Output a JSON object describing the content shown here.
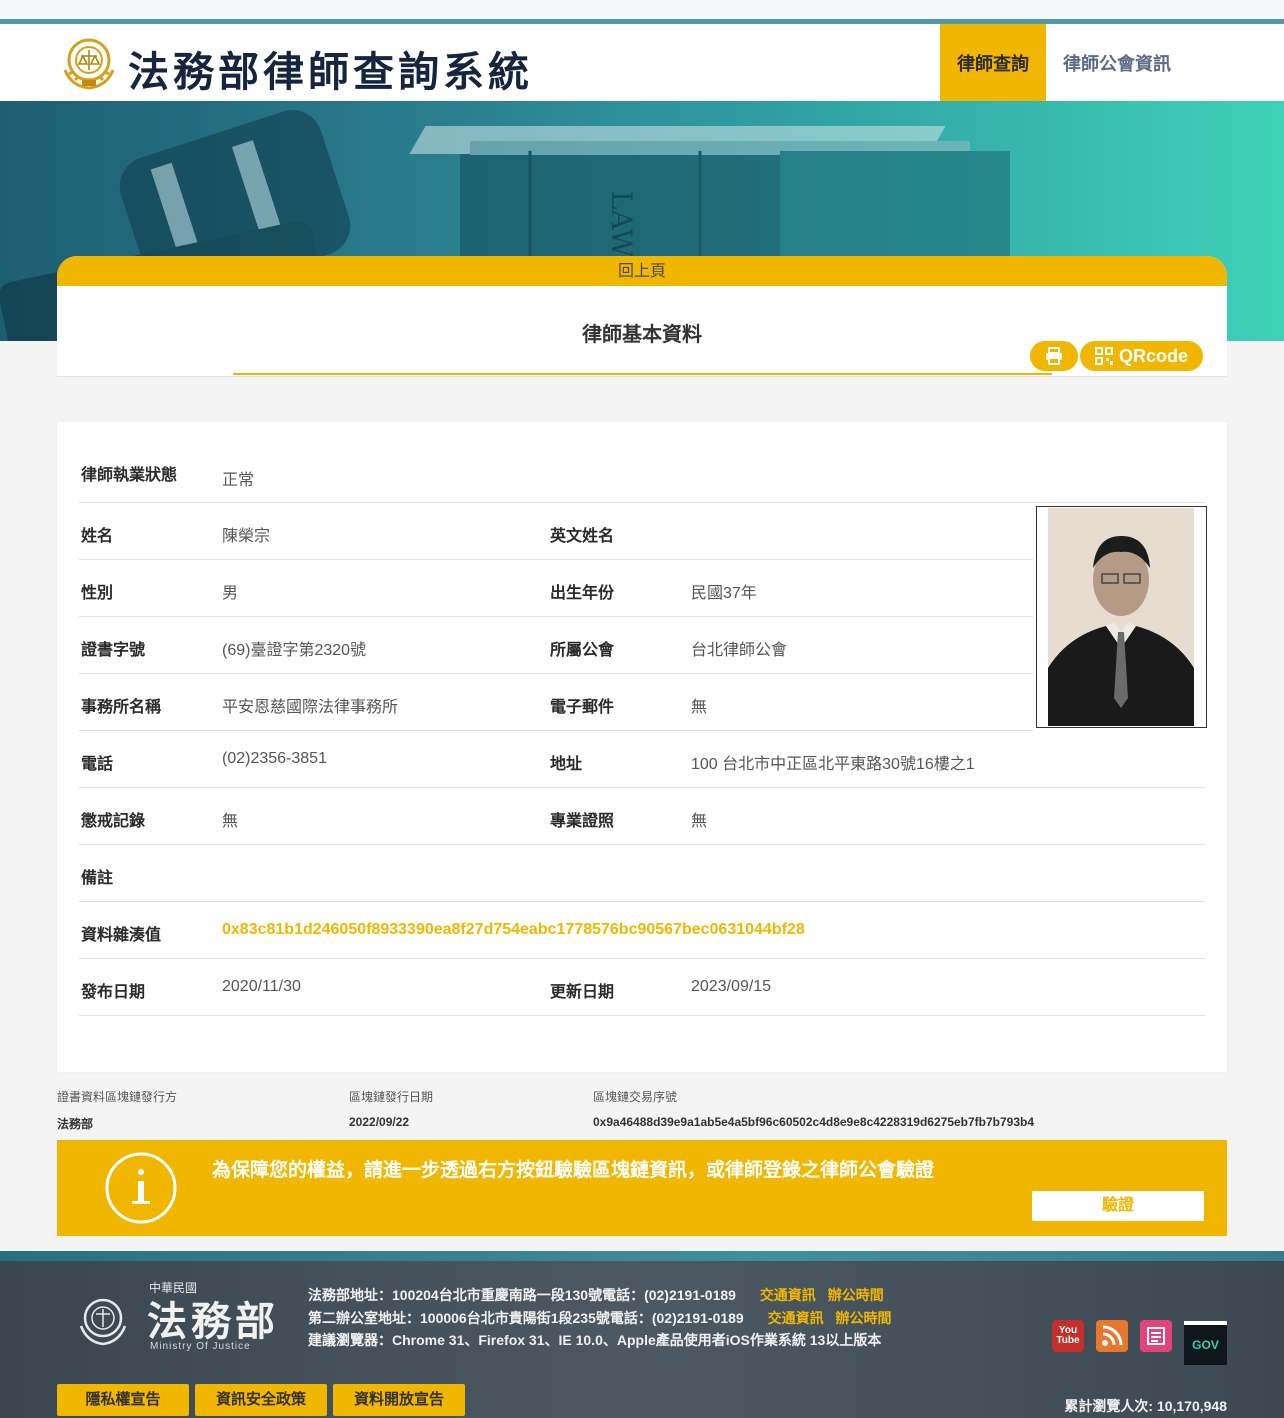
{
  "header": {
    "site_title": "法務部律師查詢系統",
    "nav": [
      {
        "label": "律師查詢"
      },
      {
        "label": "律師公會資訊"
      }
    ]
  },
  "banner": {
    "book_text": "LAW"
  },
  "card": {
    "back_label": "回上頁",
    "title": "律師基本資料",
    "qr_label": "QRcode"
  },
  "lawyer": {
    "status": {
      "label": "律師執業狀態",
      "value": "正常"
    },
    "name": {
      "label": "姓名",
      "value": "陳榮宗"
    },
    "english_name": {
      "label": "英文姓名",
      "value": ""
    },
    "gender": {
      "label": "性別",
      "value": "男"
    },
    "birth_year": {
      "label": "出生年份",
      "value": "民國37年"
    },
    "cert_no": {
      "label": "證書字號",
      "value": "(69)臺證字第2320號"
    },
    "association": {
      "label": "所屬公會",
      "value": "台北律師公會"
    },
    "office": {
      "label": "事務所名稱",
      "value": "平安恩慈國際法律事務所"
    },
    "email": {
      "label": "電子郵件",
      "value": "無"
    },
    "phone": {
      "label": "電話",
      "value": "(02)2356-3851"
    },
    "address": {
      "label": "地址",
      "value": "100 台北市中正區北平東路30號16樓之1"
    },
    "discipline": {
      "label": "懲戒記錄",
      "value": "無"
    },
    "pro_license": {
      "label": "專業證照",
      "value": "無"
    },
    "remark": {
      "label": "備註",
      "value": ""
    },
    "hash": {
      "label": "資料雜湊值",
      "value": "0x83c81b1d246050f8933390ea8f27d754eabc1778576bc90567bec0631044bf28"
    },
    "publish_date": {
      "label": "發布日期",
      "value": "2020/11/30"
    },
    "update_date": {
      "label": "更新日期",
      "value": "2023/09/15"
    }
  },
  "blockchain": {
    "issuer": {
      "label": "證書資料區塊鏈發行方",
      "value": "法務部"
    },
    "issue_date": {
      "label": "區塊鏈發行日期",
      "value": "2022/09/22"
    },
    "tx_id": {
      "label": "區塊鏈交易序號",
      "value": "0x9a46488d39e9a1ab5e4a5bf96c60502c4d8e9e8c4228319d6275eb7fb7b793b4"
    }
  },
  "notice": {
    "text": "為保障您的權益，請進一步透過右方按鈕驗驗區塊鏈資訊，或律師登錄之律師公會驗證",
    "verify_label": "驗證"
  },
  "footer": {
    "roc": "中華民國",
    "moj": "法務部",
    "moj_en": "Ministry Of Justice",
    "line1": "法務部地址：100204台北市重慶南路一段130號電話：(02)2191-0189",
    "line2": "第二辦公室地址：100006台北市貴陽街1段235號電話：(02)2191-0189",
    "line3": "建議瀏覽器：Chrome 31、Firefox 31、IE 10.0、Apple產品使用者iOS作業系統 13以上版本",
    "traffic": "交通資訊",
    "hours": "辦公時間",
    "links": [
      "隱私權宣告",
      "資訊安全政策",
      "資料開放宣告"
    ],
    "visits": "累計瀏覽人次: 10,170,948",
    "gov_label": "GOV",
    "youtube_label": "You Tube"
  },
  "colors": {
    "accent": "#f1b600",
    "navy": "#15243f",
    "teal": "#2f9ea3"
  }
}
